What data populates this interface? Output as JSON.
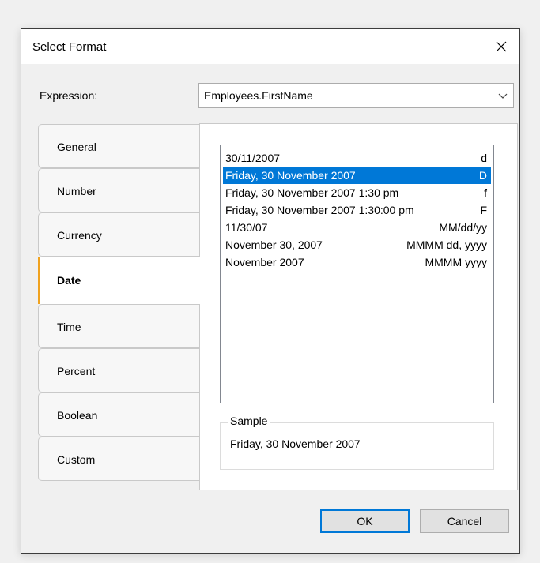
{
  "dialog": {
    "title": "Select Format",
    "close_icon": "close-icon"
  },
  "expression": {
    "label": "Expression:",
    "value": "Employees.FirstName",
    "arrow_icon": "chevron-down-icon"
  },
  "tabs": [
    {
      "label": "General",
      "active": false
    },
    {
      "label": "Number",
      "active": false
    },
    {
      "label": "Currency",
      "active": false
    },
    {
      "label": "Date",
      "active": true
    },
    {
      "label": "Time",
      "active": false
    },
    {
      "label": "Percent",
      "active": false
    },
    {
      "label": "Boolean",
      "active": false
    },
    {
      "label": "Custom",
      "active": false
    }
  ],
  "formats": [
    {
      "text": "30/11/2007",
      "code": "d",
      "selected": false
    },
    {
      "text": "Friday, 30 November 2007",
      "code": "D",
      "selected": true
    },
    {
      "text": "Friday, 30 November 2007 1:30 pm",
      "code": "f",
      "selected": false
    },
    {
      "text": "Friday, 30 November 2007 1:30:00 pm",
      "code": "F",
      "selected": false
    },
    {
      "text": "11/30/07",
      "code": "MM/dd/yy",
      "selected": false
    },
    {
      "text": "November 30, 2007",
      "code": "MMMM dd, yyyy",
      "selected": false
    },
    {
      "text": "November 2007",
      "code": "MMMM yyyy",
      "selected": false
    }
  ],
  "sample": {
    "label": "Sample",
    "value": "Friday, 30 November 2007"
  },
  "buttons": {
    "ok": "OK",
    "cancel": "Cancel"
  },
  "colors": {
    "selection": "#0078d7",
    "active_tab_accent": "#f0a21f",
    "default_button_border": "#0078d7"
  }
}
